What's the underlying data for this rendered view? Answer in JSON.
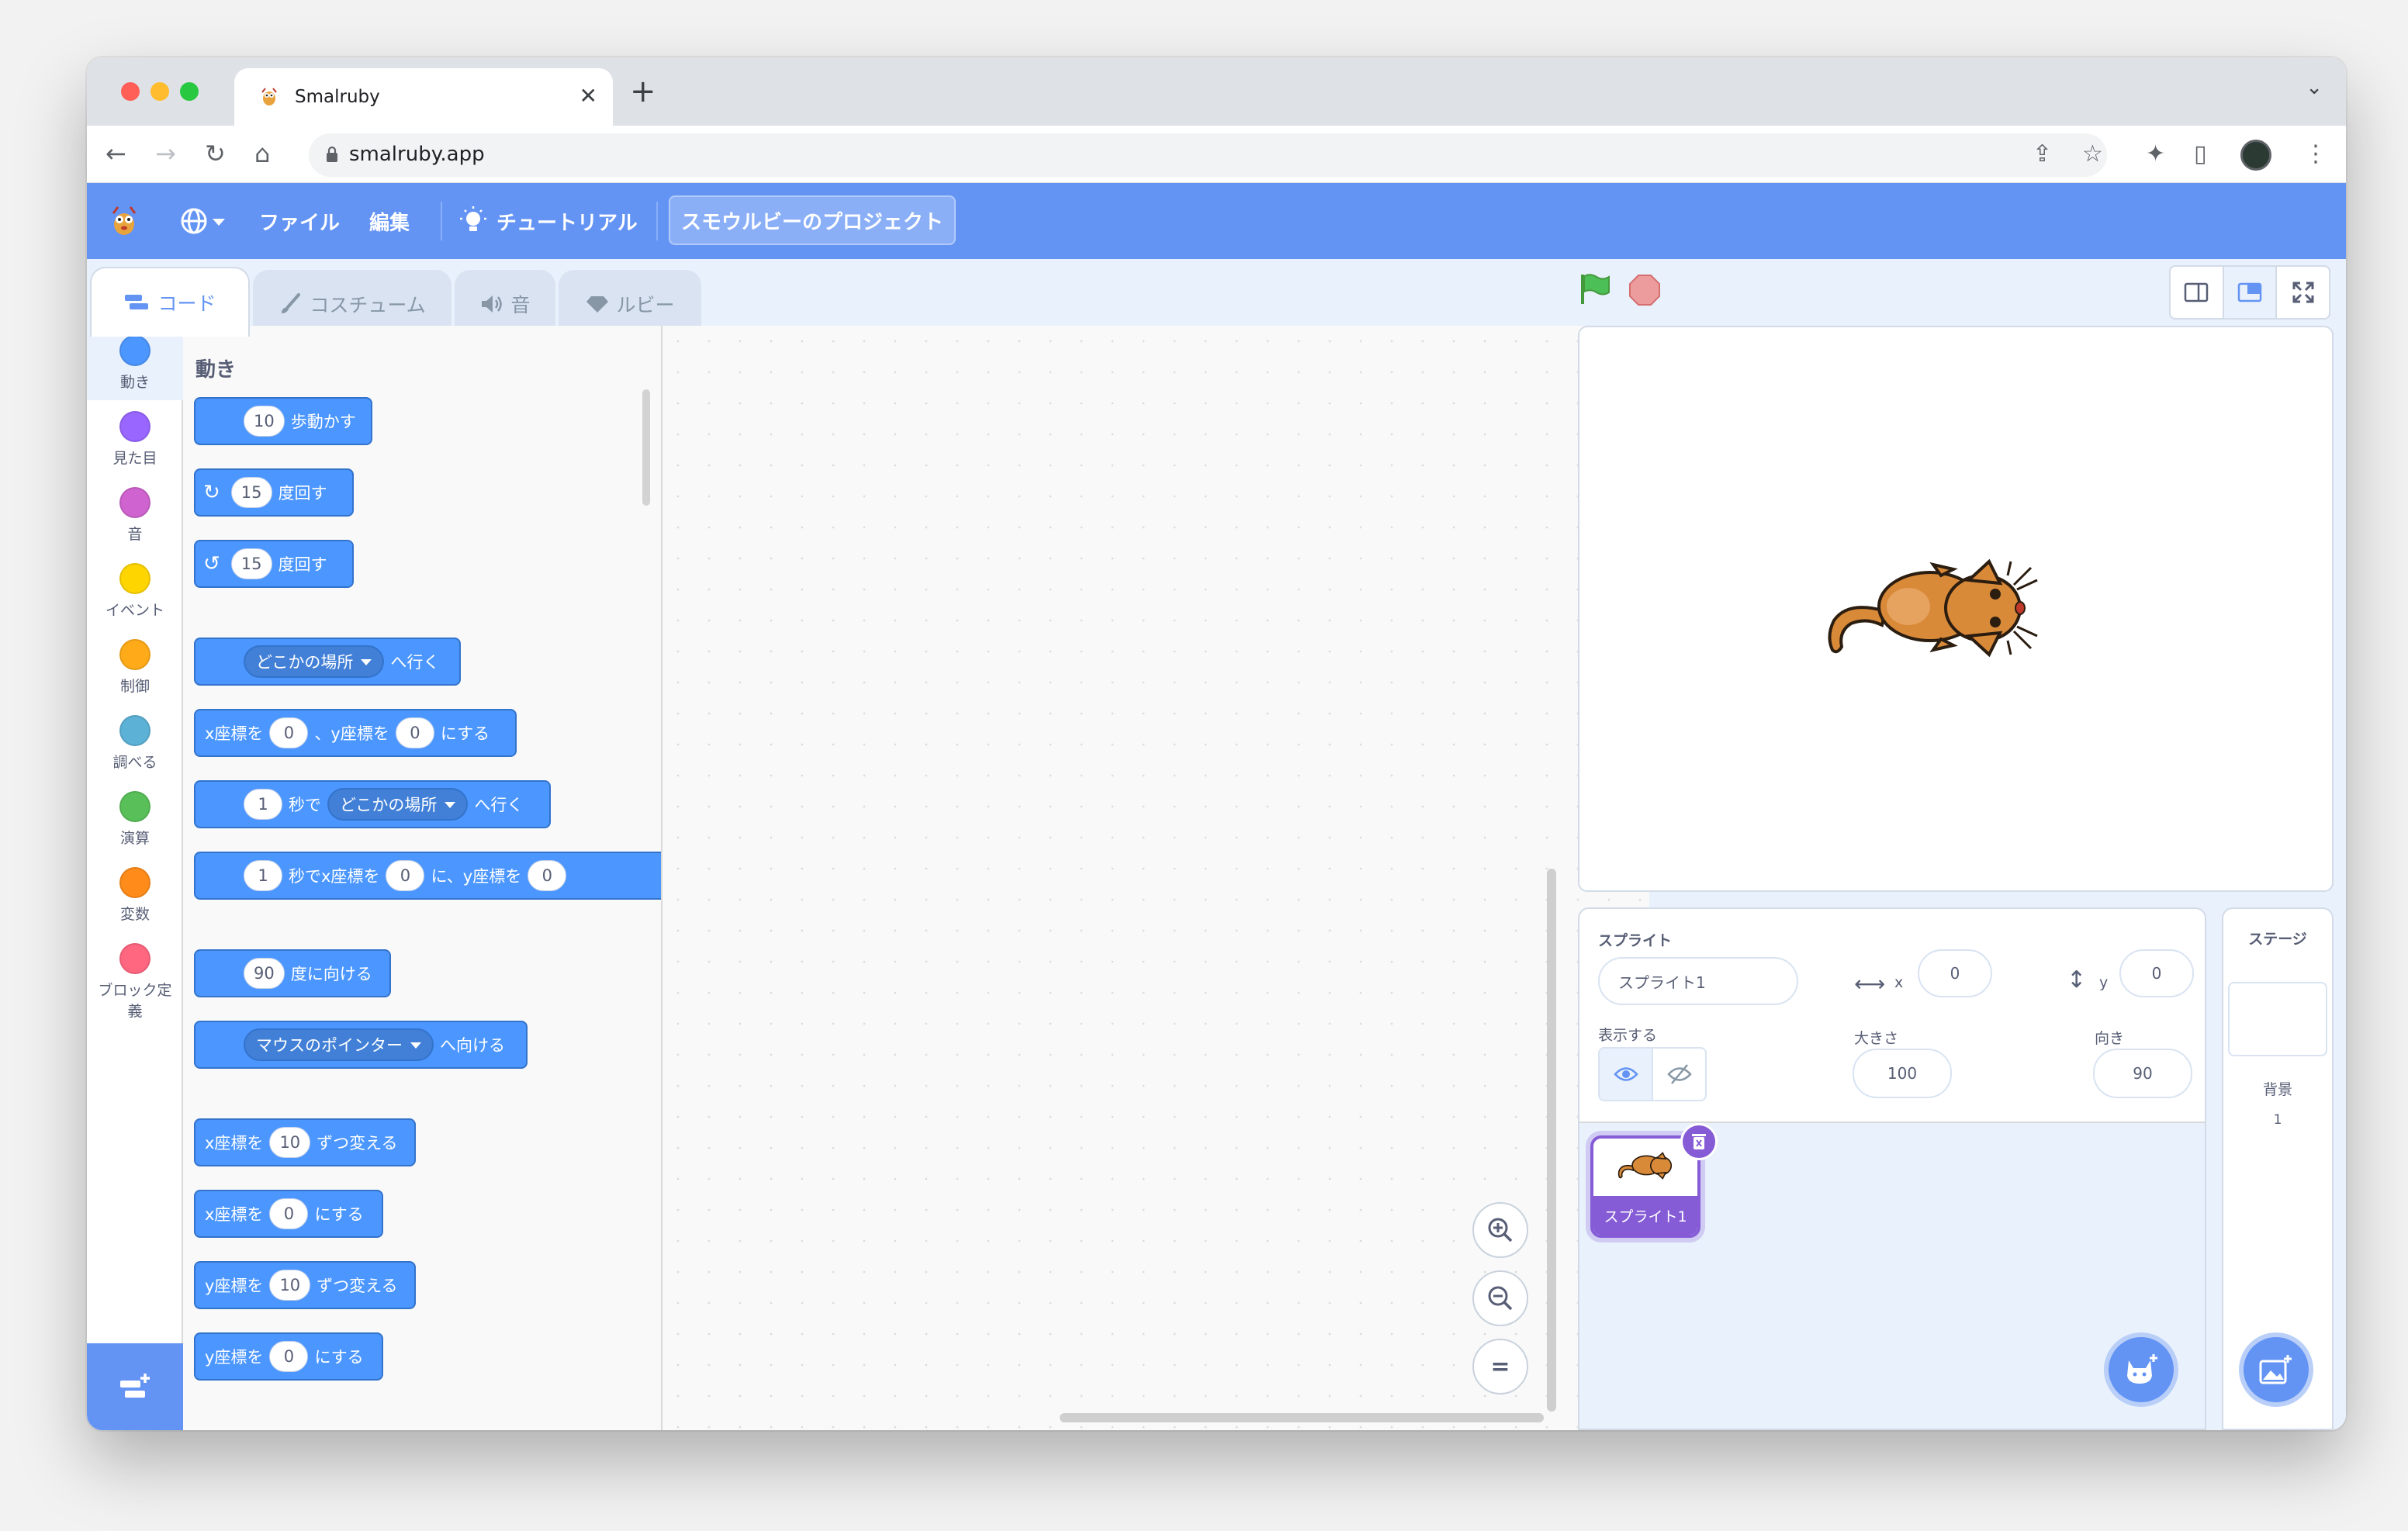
{
  "browser": {
    "tab_title": "Smalruby",
    "url": "smalruby.app"
  },
  "menubar": {
    "file": "ファイル",
    "edit": "編集",
    "tutorial": "チュートリアル",
    "project_title": "スモウルビーのプロジェクト"
  },
  "editor_tabs": {
    "code": "コード",
    "costume": "コスチューム",
    "sound": "音",
    "ruby": "ルビー"
  },
  "categories": [
    {
      "label": "動き",
      "color": "#4c97ff"
    },
    {
      "label": "見た目",
      "color": "#9966ff"
    },
    {
      "label": "音",
      "color": "#cf63cf"
    },
    {
      "label": "イベント",
      "color": "#ffd500"
    },
    {
      "label": "制御",
      "color": "#ffab19"
    },
    {
      "label": "調べる",
      "color": "#5cb1d6"
    },
    {
      "label": "演算",
      "color": "#59c059"
    },
    {
      "label": "変数",
      "color": "#ff8c1a"
    },
    {
      "label": "ブロック定",
      "label2": "義",
      "color": "#ff6680"
    }
  ],
  "flyout": {
    "heading": "動き",
    "move_steps": "10",
    "move_label": "歩動かす",
    "turn_right_deg": "15",
    "turn_label": "度回す",
    "turn_left_deg": "15",
    "goto_menu": "どこかの場所",
    "goto_label": "へ行く",
    "xy_x": "x座標を",
    "xy_x_val": "0",
    "xy_y": "、y座標を",
    "xy_y_val": "0",
    "nisuru": "にする",
    "glide_secs": "1",
    "glide_label": "秒で",
    "glide_menu": "どこかの場所",
    "glide_xy_secs": "1",
    "glide_xy_label": "秒でx座標を",
    "glide_xy_x": "0",
    "glide_xy_mid": "に、y座標を",
    "glide_xy_y": "0",
    "point_dir": "90",
    "point_label": "度に向ける",
    "point_towards_menu": "マウスのポインター",
    "point_towards_label": "へ向ける",
    "change_x_label": "x座標を",
    "change_x_val": "10",
    "change_label": "ずつ変える",
    "set_x_label": "x座標を",
    "set_x_val": "0",
    "change_y_label": "y座標を",
    "change_y_val": "10",
    "set_y_label": "y座標を",
    "set_y_val": "0"
  },
  "sprite_info": {
    "sprite_label": "スプライト",
    "sprite_name": "スプライト1",
    "x_label": "x",
    "x_value": "0",
    "y_label": "y",
    "y_value": "0",
    "show_label": "表示する",
    "size_label": "大きさ",
    "size_value": "100",
    "direction_label": "向き",
    "direction_value": "90"
  },
  "sprite_list": [
    {
      "name": "スプライト1"
    }
  ],
  "stage_pane": {
    "title": "ステージ",
    "backdrop_label": "背景",
    "backdrop_count": "1"
  },
  "colors": {
    "menubar": "#6394f4",
    "motion": "#4c97ff",
    "accent": "#855cd6"
  }
}
